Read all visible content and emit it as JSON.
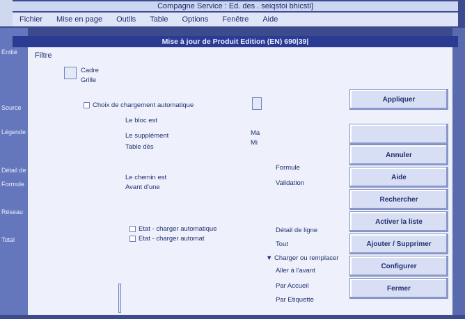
{
  "app": {
    "title": "Compagne Service : Ed. des . seiqstoi bhicsti]"
  },
  "menu": [
    "Fichier",
    "Mise en page",
    "Outils",
    "Table",
    "Options",
    "Fenêtre",
    "Aide"
  ],
  "dialog": {
    "title": "Mise à jour de Produit Edition (EN) 690|39|",
    "header_label": "Filtre",
    "radio_a": "Cadre",
    "radio_b": "Grille",
    "checkbox_line": "Choix de chargement automatique",
    "mid_labels": [
      "Le bloc est",
      "Le supplément",
      "Table dès"
    ],
    "mid_labels2": [
      "Le chemin est",
      "Avant d'une"
    ],
    "cb_list": [
      "Etat - charger automatique",
      "Etat - charger automat"
    ],
    "right_labels": [
      "Ma",
      "Mi"
    ],
    "right_labels2": [
      "Formule",
      "Validation"
    ],
    "right_list": [
      "Détail de ligne",
      "Tout",
      "Charger ou remplacer",
      "Aller à l'avant",
      "Par Accueil",
      "Par Etiquette"
    ],
    "left_labels": [
      "Entité",
      "Source",
      "Légende de",
      "Détail de",
      "Formule",
      "Réseau",
      "Total"
    ]
  },
  "buttons": [
    "Appliquer",
    "",
    "Annuler",
    "Aide",
    "Rechercher",
    "Activer la liste",
    "Ajouter / Supprimer",
    "Configurer",
    "Fermer"
  ]
}
